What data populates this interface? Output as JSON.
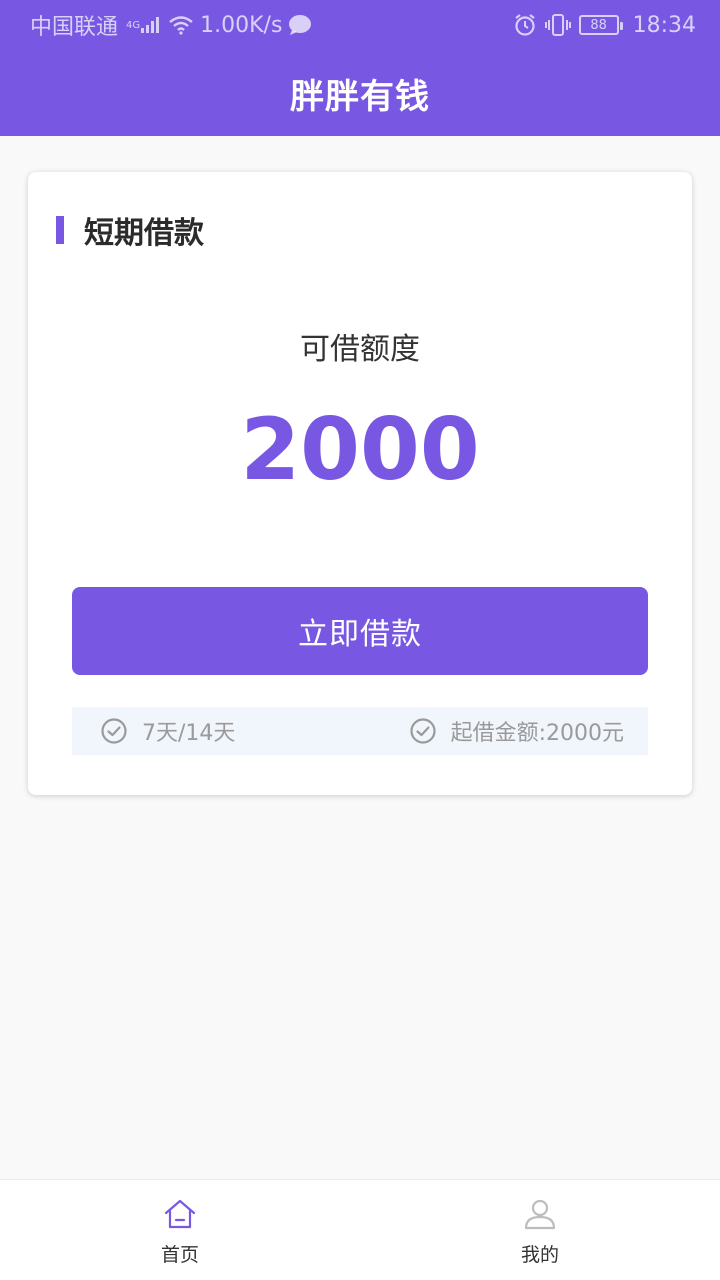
{
  "status_bar": {
    "carrier": "中国联通",
    "network": "4G",
    "speed": "1.00K/s",
    "battery": "88",
    "time": "18:34"
  },
  "header": {
    "title": "胖胖有钱"
  },
  "card": {
    "title": "短期借款",
    "quota_label": "可借额度",
    "quota_amount": "2000",
    "button_label": "立即借款",
    "info": [
      {
        "text": "7天/14天"
      },
      {
        "text": "起借金额:2000元"
      }
    ]
  },
  "bottom_nav": {
    "items": [
      {
        "label": "首页",
        "icon": "home-icon",
        "active": true
      },
      {
        "label": "我的",
        "icon": "user-icon",
        "active": false
      }
    ]
  },
  "colors": {
    "accent": "#7858e3",
    "info_strip_bg": "#f1f6fc",
    "inactive_icon": "#bdbdbd"
  }
}
